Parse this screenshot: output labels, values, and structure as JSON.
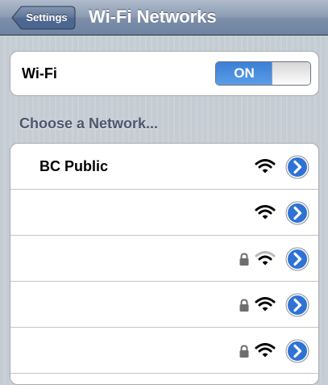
{
  "navbar": {
    "back_label": "Settings",
    "title": "Wi-Fi Networks"
  },
  "wifi": {
    "label": "Wi-Fi",
    "toggle_state": "ON"
  },
  "section_header": "Choose a Network...",
  "networks": [
    {
      "name": "BC Public",
      "locked": false,
      "signal": "strong"
    },
    {
      "name": "",
      "locked": false,
      "signal": "strong"
    },
    {
      "name": "",
      "locked": true,
      "signal": "weak"
    },
    {
      "name": "",
      "locked": true,
      "signal": "strong"
    },
    {
      "name": "",
      "locked": true,
      "signal": "strong"
    }
  ],
  "icons": {
    "back": "chevron-left-icon",
    "wifi": "wifi-signal-icon",
    "lock": "lock-icon",
    "detail": "detail-disclosure-icon"
  },
  "colors": {
    "accent_blue": "#3a7fd5",
    "navbar": "#6d84a2",
    "section_text": "#4c566c"
  }
}
